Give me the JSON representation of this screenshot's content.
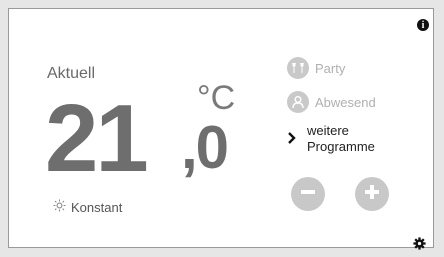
{
  "current": {
    "label": "Aktuell",
    "temp_int": "21",
    "temp_dec": ",0",
    "unit": "°C",
    "mode_label": "Konstant",
    "mode_icon": "sun-icon"
  },
  "programs": [
    {
      "label": "Party",
      "icon": "party-icon"
    },
    {
      "label": "Abwesend",
      "icon": "away-icon"
    }
  ],
  "more": {
    "line1": "weitere",
    "line2": "Programme",
    "icon": "chevron-right-icon"
  },
  "controls": {
    "minus": "minus-button",
    "plus": "plus-button"
  },
  "corner": {
    "info": "i",
    "info_icon": "info-icon",
    "settings_icon": "gear-icon"
  },
  "colors": {
    "accent_grey": "#c8c8c8",
    "text_dark": "#6e6e6e"
  }
}
